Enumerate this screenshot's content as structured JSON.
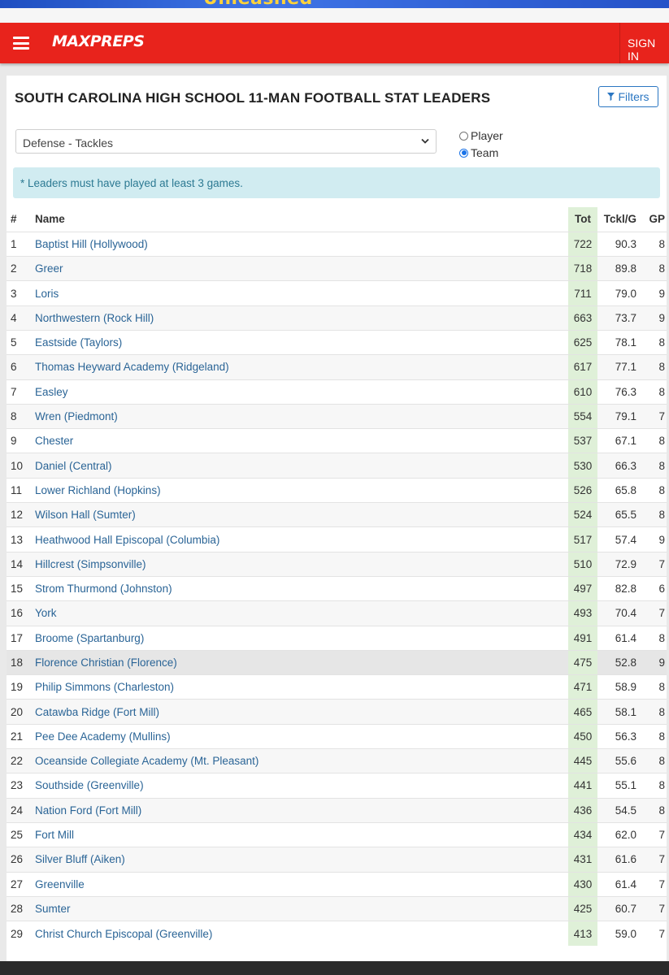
{
  "ad": {
    "text": "Unleashed"
  },
  "header": {
    "logo": "MAXPREPS",
    "sign_in": "SIGN IN"
  },
  "page": {
    "title": "SOUTH CAROLINA HIGH SCHOOL 11-MAN FOOTBALL STAT LEADERS",
    "filters_label": "Filters",
    "category_select": "Defense - Tackles",
    "radio": {
      "player": "Player",
      "team": "Team",
      "selected": "Team"
    },
    "notice": "* Leaders must have played at least 3 games."
  },
  "table": {
    "headers": {
      "rank": "#",
      "name": "Name",
      "tot": "Tot",
      "tpg": "Tckl/G",
      "gp": "GP"
    },
    "rows": [
      {
        "rank": "1",
        "name": "Baptist Hill (Hollywood)",
        "tot": "722",
        "tpg": "90.3",
        "gp": "8"
      },
      {
        "rank": "2",
        "name": "Greer",
        "tot": "718",
        "tpg": "89.8",
        "gp": "8"
      },
      {
        "rank": "3",
        "name": "Loris",
        "tot": "711",
        "tpg": "79.0",
        "gp": "9"
      },
      {
        "rank": "4",
        "name": "Northwestern (Rock Hill)",
        "tot": "663",
        "tpg": "73.7",
        "gp": "9"
      },
      {
        "rank": "5",
        "name": "Eastside (Taylors)",
        "tot": "625",
        "tpg": "78.1",
        "gp": "8"
      },
      {
        "rank": "6",
        "name": "Thomas Heyward Academy (Ridgeland)",
        "tot": "617",
        "tpg": "77.1",
        "gp": "8"
      },
      {
        "rank": "7",
        "name": "Easley",
        "tot": "610",
        "tpg": "76.3",
        "gp": "8"
      },
      {
        "rank": "8",
        "name": "Wren (Piedmont)",
        "tot": "554",
        "tpg": "79.1",
        "gp": "7"
      },
      {
        "rank": "9",
        "name": "Chester",
        "tot": "537",
        "tpg": "67.1",
        "gp": "8"
      },
      {
        "rank": "10",
        "name": "Daniel (Central)",
        "tot": "530",
        "tpg": "66.3",
        "gp": "8"
      },
      {
        "rank": "11",
        "name": "Lower Richland (Hopkins)",
        "tot": "526",
        "tpg": "65.8",
        "gp": "8"
      },
      {
        "rank": "12",
        "name": "Wilson Hall (Sumter)",
        "tot": "524",
        "tpg": "65.5",
        "gp": "8"
      },
      {
        "rank": "13",
        "name": "Heathwood Hall Episcopal (Columbia)",
        "tot": "517",
        "tpg": "57.4",
        "gp": "9"
      },
      {
        "rank": "14",
        "name": "Hillcrest (Simpsonville)",
        "tot": "510",
        "tpg": "72.9",
        "gp": "7"
      },
      {
        "rank": "15",
        "name": "Strom Thurmond (Johnston)",
        "tot": "497",
        "tpg": "82.8",
        "gp": "6"
      },
      {
        "rank": "16",
        "name": "York",
        "tot": "493",
        "tpg": "70.4",
        "gp": "7"
      },
      {
        "rank": "17",
        "name": "Broome (Spartanburg)",
        "tot": "491",
        "tpg": "61.4",
        "gp": "8"
      },
      {
        "rank": "18",
        "name": "Florence Christian (Florence)",
        "tot": "475",
        "tpg": "52.8",
        "gp": "9"
      },
      {
        "rank": "19",
        "name": "Philip Simmons (Charleston)",
        "tot": "471",
        "tpg": "58.9",
        "gp": "8"
      },
      {
        "rank": "20",
        "name": "Catawba Ridge (Fort Mill)",
        "tot": "465",
        "tpg": "58.1",
        "gp": "8"
      },
      {
        "rank": "21",
        "name": "Pee Dee Academy (Mullins)",
        "tot": "450",
        "tpg": "56.3",
        "gp": "8"
      },
      {
        "rank": "22",
        "name": "Oceanside Collegiate Academy (Mt. Pleasant)",
        "tot": "445",
        "tpg": "55.6",
        "gp": "8"
      },
      {
        "rank": "23",
        "name": "Southside (Greenville)",
        "tot": "441",
        "tpg": "55.1",
        "gp": "8"
      },
      {
        "rank": "24",
        "name": "Nation Ford (Fort Mill)",
        "tot": "436",
        "tpg": "54.5",
        "gp": "8"
      },
      {
        "rank": "25",
        "name": "Fort Mill",
        "tot": "434",
        "tpg": "62.0",
        "gp": "7"
      },
      {
        "rank": "26",
        "name": "Silver Bluff (Aiken)",
        "tot": "431",
        "tpg": "61.6",
        "gp": "7"
      },
      {
        "rank": "27",
        "name": "Greenville",
        "tot": "430",
        "tpg": "61.4",
        "gp": "7"
      },
      {
        "rank": "28",
        "name": "Sumter",
        "tot": "425",
        "tpg": "60.7",
        "gp": "7"
      },
      {
        "rank": "29",
        "name": "Christ Church Episcopal (Greenville)",
        "tot": "413",
        "tpg": "59.0",
        "gp": "7"
      }
    ],
    "highlighted_rank": "18"
  },
  "colors": {
    "brand_red": "#e8231c",
    "link_blue": "#2a6496",
    "tot_column_bg": "#dff0d8",
    "notice_bg": "#d1ecf1"
  }
}
